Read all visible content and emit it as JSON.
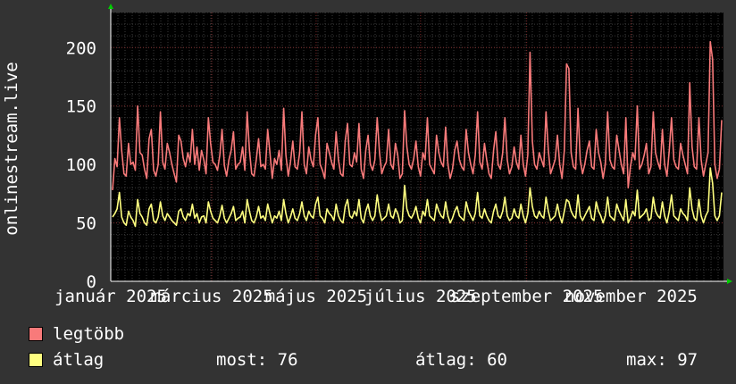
{
  "chart_data": {
    "type": "line",
    "ylabel": "onlinestream.live",
    "ylim": [
      0,
      230
    ],
    "yticks": [
      0,
      50,
      100,
      150,
      200
    ],
    "xtick_labels": [
      "január 2025",
      "március 2025",
      "május 2025",
      "július 2025",
      "szeptember 2025",
      "november 2025"
    ],
    "x_range": [
      "2025-01-01",
      "2025-12-25"
    ],
    "grid": true,
    "series": [
      {
        "name": "legtöbb",
        "color": "#f87a7a",
        "values": [
          78,
          105,
          98,
          140,
          112,
          92,
          90,
          118,
          100,
          102,
          95,
          150,
          110,
          108,
          96,
          88,
          122,
          130,
          95,
          90,
          100,
          145,
          102,
          96,
          118,
          110,
          100,
          92,
          85,
          125,
          120,
          105,
          98,
          110,
          102,
          130,
          100,
          115,
          95,
          112,
          104,
          92,
          140,
          118,
          102,
          100,
          95,
          108,
          130,
          99,
          90,
          104,
          112,
          128,
          96,
          100,
          102,
          115,
          95,
          145,
          112,
          92,
          90,
          104,
          122,
          98,
          100,
          96,
          130,
          110,
          88,
          105,
          100,
          112,
          95,
          148,
          108,
          90,
          102,
          120,
          98,
          96,
          110,
          145,
          100,
          92,
          115,
          104,
          98,
          125,
          140,
          100,
          95,
          88,
          118,
          110,
          102,
          96,
          128,
          104,
          92,
          90,
          120,
          135,
          100,
          98,
          110,
          102,
          135,
          96,
          88,
          112,
          125,
          100,
          95,
          104,
          140,
          110,
          92,
          98,
          102,
          130,
          100,
          96,
          118,
          108,
          88,
          92,
          146,
          115,
          100,
          96,
          105,
          120,
          98,
          90,
          110,
          104,
          140,
          100,
          96,
          92,
          125,
          110,
          102,
          98,
          132,
          100,
          88,
          96,
          112,
          120,
          104,
          98,
          95,
          130,
          110,
          100,
          92,
          108,
          145,
          102,
          96,
          118,
          104,
          92,
          88,
          112,
          128,
          100,
          96,
          110,
          140,
          104,
          92,
          98,
          115,
          102,
          96,
          125,
          100,
          90,
          108,
          196,
          120,
          100,
          96,
          110,
          104,
          98,
          145,
          112,
          92,
          98,
          104,
          125,
          100,
          88,
          112,
          186,
          182,
          110,
          98,
          96,
          148,
          104,
          92,
          100,
          112,
          120,
          98,
          96,
          130,
          110,
          102,
          88,
          100,
          145,
          104,
          98,
          96,
          125,
          112,
          100,
          92,
          140,
          80,
          98,
          110,
          104,
          150,
          96,
          100,
          108,
          118,
          92,
          98,
          145,
          110,
          102,
          96,
          130,
          100,
          90,
          112,
          140,
          104,
          98,
          96,
          118,
          108,
          100,
          92,
          170,
          115,
          98,
          96,
          140,
          104,
          90,
          100,
          110,
          205,
          190,
          100,
          88,
          96,
          138
        ]
      },
      {
        "name": "átlag",
        "color": "#ffff80",
        "values": [
          55,
          58,
          62,
          76,
          55,
          50,
          48,
          60,
          55,
          52,
          47,
          70,
          58,
          55,
          50,
          48,
          62,
          66,
          52,
          50,
          55,
          68,
          56,
          52,
          58,
          55,
          52,
          50,
          48,
          60,
          62,
          55,
          52,
          58,
          56,
          66,
          54,
          58,
          50,
          55,
          56,
          50,
          68,
          60,
          54,
          52,
          50,
          56,
          65,
          54,
          50,
          54,
          58,
          64,
          52,
          54,
          55,
          60,
          50,
          70,
          60,
          52,
          50,
          55,
          64,
          54,
          56,
          52,
          66,
          58,
          50,
          56,
          54,
          60,
          52,
          70,
          58,
          50,
          55,
          62,
          54,
          52,
          58,
          68,
          56,
          52,
          60,
          56,
          54,
          66,
          72,
          56,
          54,
          50,
          62,
          58,
          56,
          52,
          66,
          56,
          52,
          50,
          64,
          70,
          56,
          54,
          60,
          56,
          70,
          54,
          50,
          60,
          66,
          56,
          52,
          56,
          74,
          60,
          52,
          54,
          56,
          66,
          56,
          54,
          62,
          58,
          50,
          52,
          82,
          62,
          56,
          54,
          58,
          64,
          54,
          50,
          60,
          56,
          70,
          56,
          54,
          52,
          66,
          60,
          56,
          54,
          68,
          56,
          50,
          54,
          60,
          64,
          56,
          54,
          52,
          68,
          60,
          56,
          52,
          58,
          76,
          56,
          54,
          62,
          56,
          52,
          50,
          60,
          66,
          56,
          54,
          60,
          72,
          56,
          52,
          54,
          62,
          56,
          54,
          66,
          56,
          50,
          58,
          80,
          64,
          56,
          54,
          60,
          56,
          54,
          72,
          60,
          52,
          54,
          56,
          66,
          56,
          50,
          60,
          70,
          68,
          60,
          56,
          54,
          74,
          56,
          52,
          56,
          60,
          64,
          54,
          52,
          68,
          60,
          56,
          50,
          56,
          72,
          56,
          54,
          52,
          66,
          60,
          56,
          52,
          70,
          50,
          54,
          60,
          56,
          78,
          54,
          56,
          58,
          62,
          52,
          54,
          72,
          60,
          56,
          54,
          68,
          56,
          50,
          60,
          74,
          56,
          54,
          52,
          62,
          58,
          56,
          52,
          80,
          62,
          54,
          52,
          70,
          56,
          50,
          56,
          60,
          97,
          84,
          56,
          52,
          56,
          76
        ]
      }
    ]
  },
  "legend": [
    {
      "label": "legtöbb",
      "color": "#f87a7a"
    },
    {
      "label": "átlag",
      "color": "#ffff80"
    }
  ],
  "stats": {
    "now": "most: 76",
    "avg": "átlag: 60",
    "max": "max: 97"
  }
}
